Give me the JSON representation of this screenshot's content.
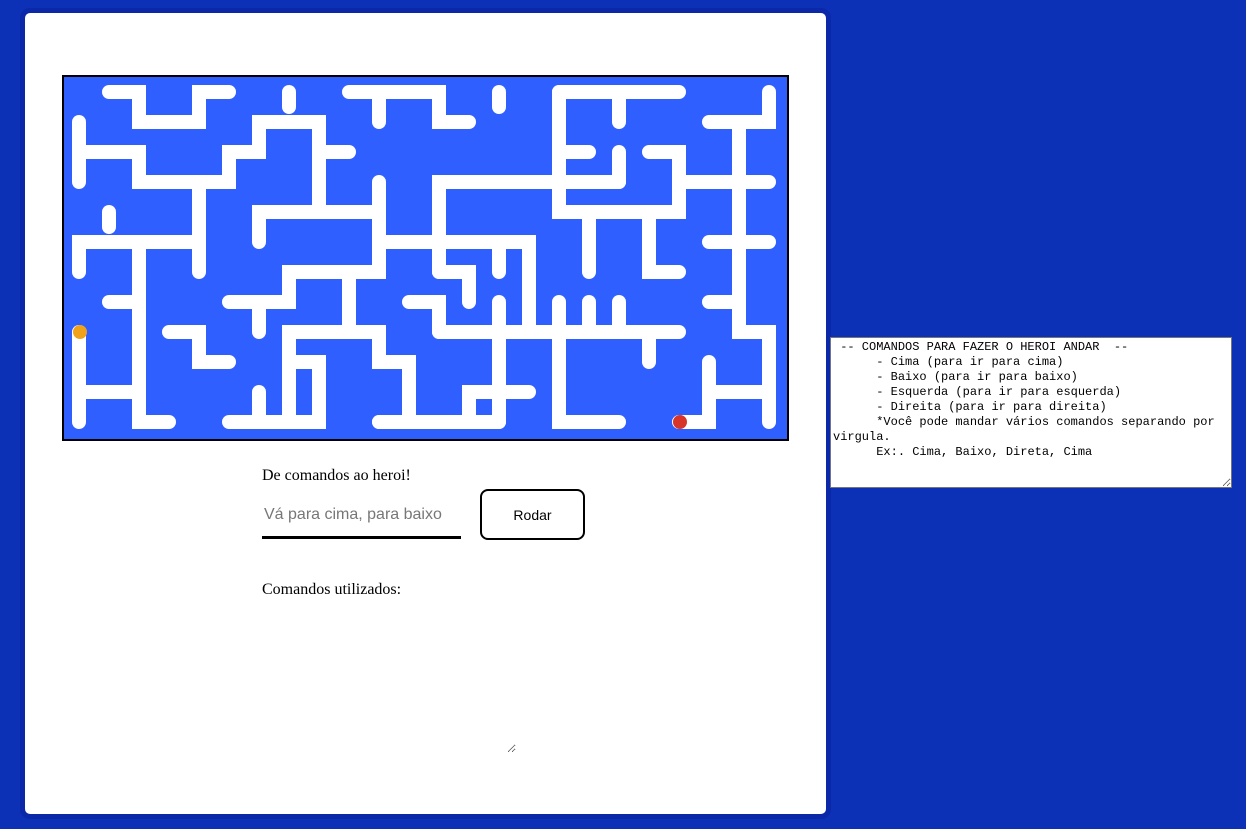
{
  "game": {
    "maze_color": "#2f5fff",
    "wall_color": "#ffffff",
    "hero_color": "#f0a31a",
    "goal_color": "#d8352a",
    "hero": "hero-dot",
    "goal": "goal-dot"
  },
  "controls": {
    "prompt": "De comandos ao heroi!",
    "input_placeholder": "Vá para cima, para baixo",
    "input_value": "",
    "run_label": "Rodar",
    "used_label": "Comandos utilizados:",
    "used_value": ""
  },
  "help": {
    "text": " -- COMANDOS PARA FAZER O HEROI ANDAR  --\n      - Cima (para ir para cima)\n      - Baixo (para ir para baixo)\n      - Esquerda (para ir para esquerda)\n      - Direita (para ir para direita)\n      *Você pode mandar vários comandos separando por virgula.\n      Ex:. Cima, Baixo, Direta, Cima"
  }
}
